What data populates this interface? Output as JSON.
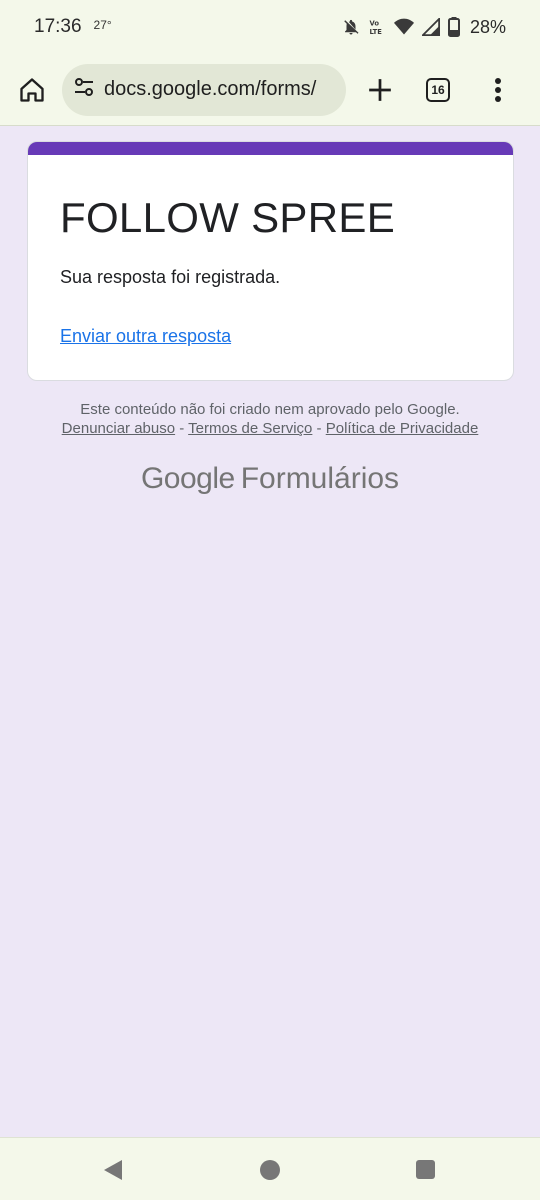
{
  "status_bar": {
    "time": "17:36",
    "temperature": "27°",
    "battery": "28%",
    "icons": [
      "bell-off-icon",
      "volte-lte-icon",
      "wifi-icon",
      "signal-icon",
      "battery-icon"
    ]
  },
  "browser": {
    "url": "docs.google.com/forms/",
    "tab_count": "16",
    "icons": [
      "home-icon",
      "site-settings-icon",
      "add-tab-icon",
      "tab-switcher-icon",
      "menu-dots-icon"
    ]
  },
  "form": {
    "title": "FOLLOW SPREE",
    "confirmation": "Sua resposta foi registrada.",
    "submit_another": "Enviar outra resposta",
    "accent_color": "#673ab7"
  },
  "footer": {
    "disclaimer": "Este conteúdo não foi criado nem aprovado pelo Google.",
    "report_abuse": "Denunciar abuso",
    "terms": "Termos de Serviço",
    "privacy": "Política de Privacidade",
    "separator": " - ",
    "brand_google": "Google",
    "brand_product": "Formulários"
  },
  "nav_bar": {
    "icons": [
      "back-icon",
      "home-circle-icon",
      "recents-icon"
    ]
  }
}
